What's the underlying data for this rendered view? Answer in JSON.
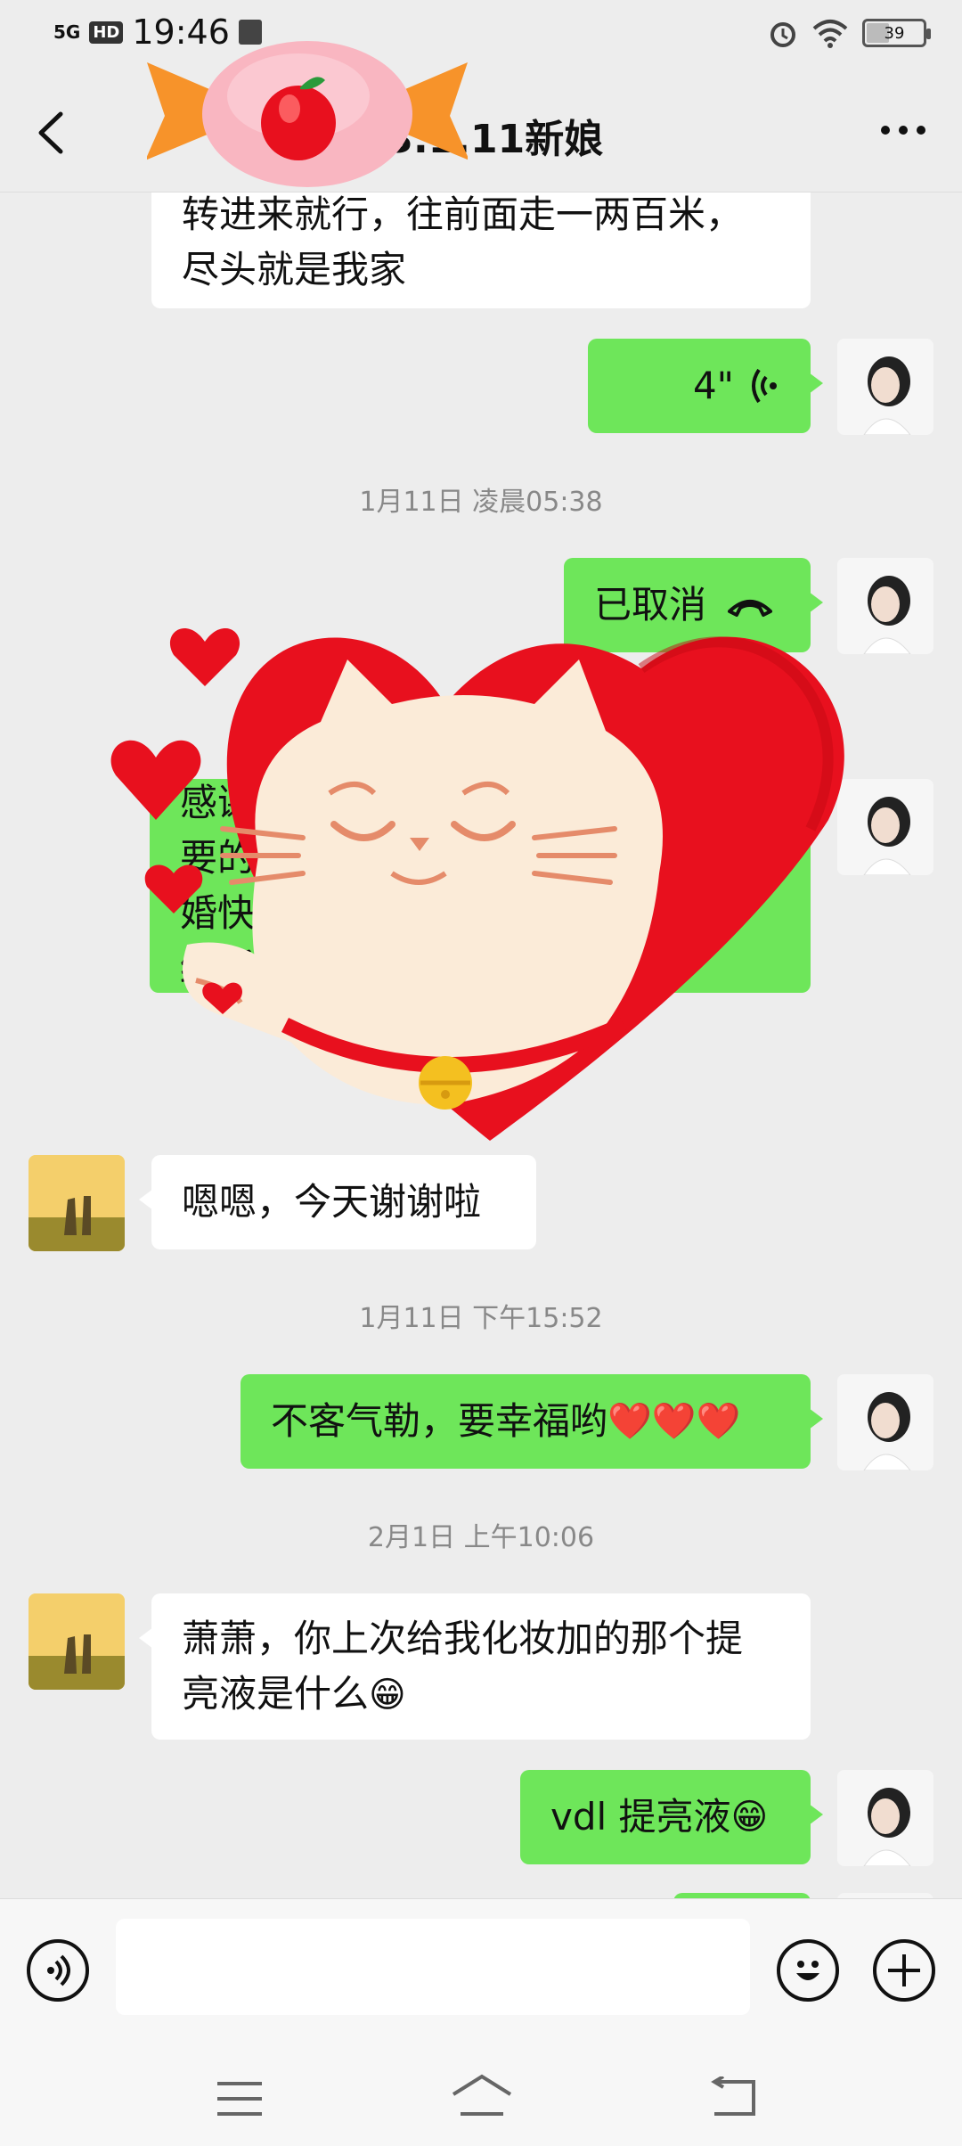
{
  "status_bar": {
    "network": "5G",
    "hd": "HD",
    "time": "19:46",
    "battery": "39"
  },
  "header": {
    "title": "23.1.11新娘"
  },
  "messages": {
    "m1": "转进来就行，往前面走一两百米，",
    "m1b": "尽头就是我家",
    "voice": "4\"",
    "time1": "1月11日 凌晨05:38",
    "cancelled": "已取消",
    "partial_lines": [
      "感谢",
      "要的",
      "婚快",
      "结婚"
    ],
    "m_thanks": "嗯嗯，今天谢谢啦",
    "time2": "1月11日 下午15:52",
    "m_welcome": "不客气勒，要幸福哟",
    "welcome_emoji": "❤️❤️❤️",
    "time3": "2月1日 上午10:06",
    "m_question_1": "萧萧，你上次给我化妆加的那个提",
    "m_question_2": "亮液是什么",
    "question_emoji": "😁",
    "m_answer": "vdl 提亮液",
    "answer_emoji": "😁"
  },
  "icons": {
    "back": "chevron-left-icon",
    "more": "more-dots-icon",
    "voice_mode": "voice-icon",
    "emoji": "smiley-icon",
    "plus": "plus-icon",
    "call": "phone-hangup-icon"
  },
  "colors": {
    "green_bubble": "#6ee65a",
    "background": "#ededed",
    "sticker_red": "#e8101e"
  }
}
